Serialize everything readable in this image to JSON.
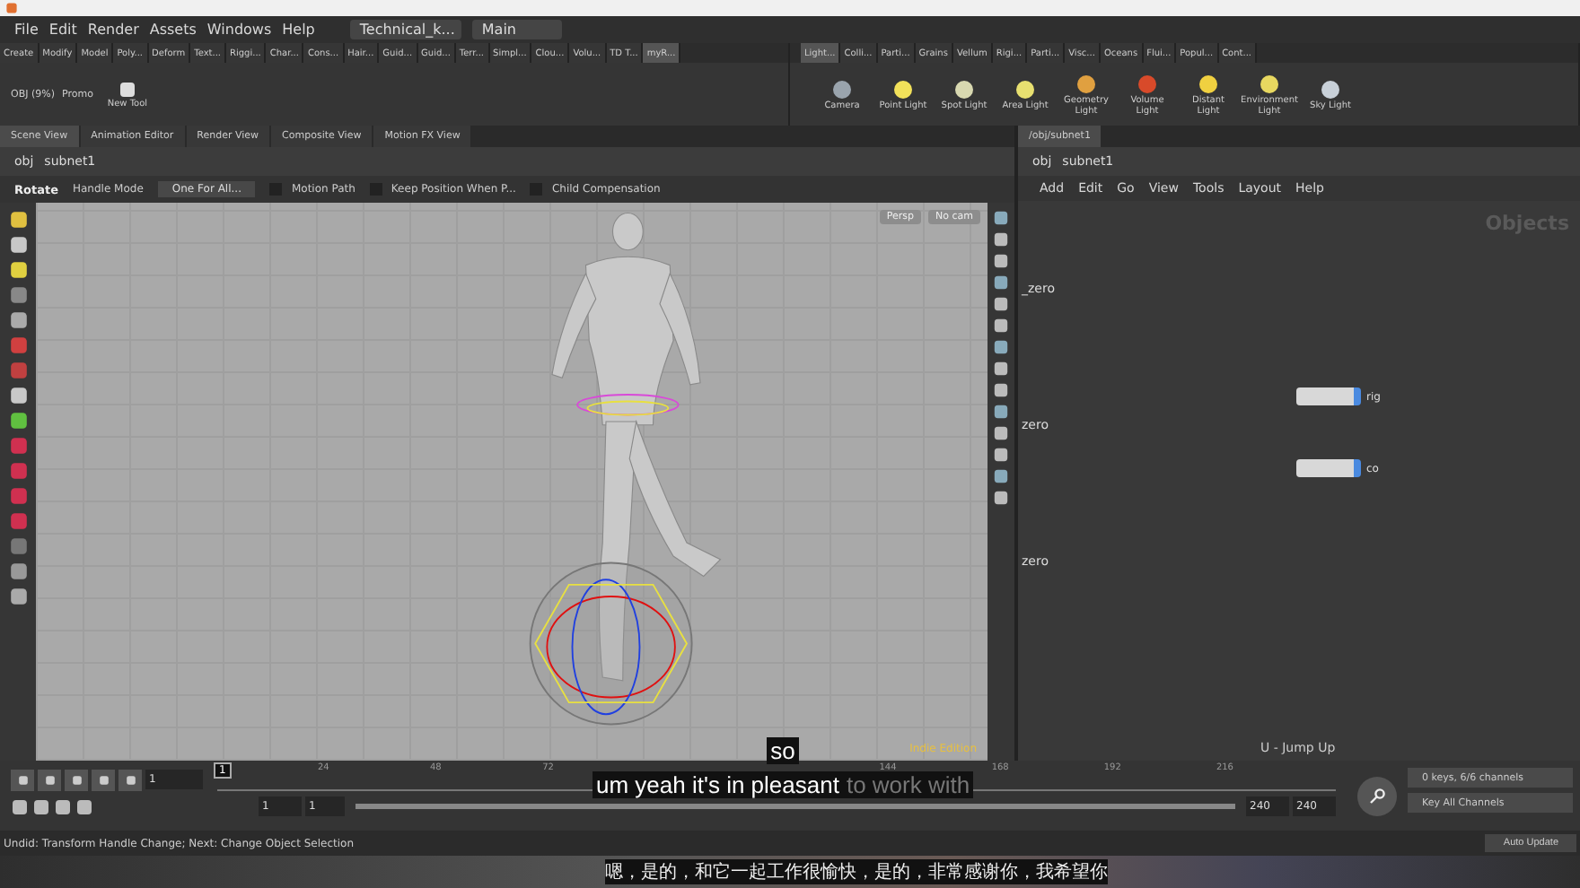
{
  "menu": [
    "File",
    "Edit",
    "Render",
    "Assets",
    "Windows",
    "Help"
  ],
  "desktop": "Technical_k...",
  "desk": "Main",
  "shelf_tabs_left": [
    {
      "label": "Create",
      "selected": false
    },
    {
      "label": "Modify",
      "selected": false
    },
    {
      "label": "Model",
      "selected": false
    },
    {
      "label": "Poly...",
      "selected": false
    },
    {
      "label": "Deform",
      "selected": false
    },
    {
      "label": "Text...",
      "selected": false
    },
    {
      "label": "Riggi...",
      "selected": false
    },
    {
      "label": "Char...",
      "selected": false
    },
    {
      "label": "Cons...",
      "selected": false
    },
    {
      "label": "Hair...",
      "selected": false
    },
    {
      "label": "Guid...",
      "selected": false
    },
    {
      "label": "Guid...",
      "selected": false
    },
    {
      "label": "Terr...",
      "selected": false
    },
    {
      "label": "Simpl...",
      "selected": false
    },
    {
      "label": "Clou...",
      "selected": false
    },
    {
      "label": "Volu...",
      "selected": false
    },
    {
      "label": "TD T...",
      "selected": false
    },
    {
      "label": "myR...",
      "selected": true
    }
  ],
  "shelf_tools_left": [
    {
      "label": "OBJ (9%)",
      "kind": "text"
    },
    {
      "label": "Promo",
      "kind": "text"
    },
    {
      "label": "New Tool",
      "kind": "icon"
    }
  ],
  "shelf_tabs_right": [
    {
      "label": "Light...",
      "selected": true
    },
    {
      "label": "Colli...",
      "selected": false
    },
    {
      "label": "Parti...",
      "selected": false
    },
    {
      "label": "Grains",
      "selected": false
    },
    {
      "label": "Vellum",
      "selected": false
    },
    {
      "label": "Rigi...",
      "selected": false
    },
    {
      "label": "Parti...",
      "selected": false
    },
    {
      "label": "Visc...",
      "selected": false
    },
    {
      "label": "Oceans",
      "selected": false
    },
    {
      "label": "Flui...",
      "selected": false
    },
    {
      "label": "Popul...",
      "selected": false
    },
    {
      "label": "Cont...",
      "selected": false
    }
  ],
  "shelf_tools_right": [
    {
      "label": "Camera",
      "color": "#9aa4ad"
    },
    {
      "label": "Point Light",
      "color": "#f2e15a"
    },
    {
      "label": "Spot Light",
      "color": "#d8d8b0"
    },
    {
      "label": "Area Light",
      "color": "#e8e070"
    },
    {
      "label": "Geometry Light",
      "color": "#e0a040"
    },
    {
      "label": "Volume Light",
      "color": "#d84a2a"
    },
    {
      "label": "Distant Light",
      "color": "#f0d040"
    },
    {
      "label": "Environment Light",
      "color": "#e8d860"
    },
    {
      "label": "Sky Light",
      "color": "#c8d0d8"
    }
  ],
  "pane_tabs": [
    {
      "label": "Scene View",
      "selected": true
    },
    {
      "label": "Animation Editor",
      "selected": false
    },
    {
      "label": "Render View",
      "selected": false
    },
    {
      "label": "Composite View",
      "selected": false
    },
    {
      "label": "Motion FX View",
      "selected": false
    }
  ],
  "network_tab": "/obj/subnet1",
  "path": [
    "obj",
    "subnet1"
  ],
  "network_path": [
    "obj",
    "subnet1"
  ],
  "tool_options": {
    "tool": "Rotate",
    "handle_label": "Handle Mode",
    "handle_mode": "One For All...",
    "checkboxes": [
      {
        "label": "Motion Path",
        "checked": false
      },
      {
        "label": "Keep Position When P...",
        "checked": false
      },
      {
        "label": "Child Compensation",
        "checked": false
      }
    ]
  },
  "viewport": {
    "camera": "Persp",
    "cam": "No cam",
    "edition": "Indie Edition"
  },
  "subtitles": {
    "line1": "so",
    "spoken": "um yeah it's in pleasant",
    "upcoming": "to work with",
    "chinese": "嗯，是的，和它一起工作很愉快，是的，非常感谢你，我希望你"
  },
  "network": {
    "menu": [
      "Add",
      "Edit",
      "Go",
      "View",
      "Tools",
      "Layout",
      "Help"
    ],
    "context": "Objects",
    "side_labels": [
      "_zero",
      "zero",
      "zero"
    ],
    "nodes": [
      {
        "label": "rig"
      },
      {
        "label": "co"
      }
    ],
    "hotkey": "U - Jump Up"
  },
  "timeline": {
    "frame": "1",
    "marker": "1",
    "ticks": [
      "24",
      "48",
      "72",
      "144",
      "168",
      "192",
      "216"
    ],
    "range_bar": {
      "level": 1
    },
    "start": "1",
    "range_start": "1",
    "range_end": "240",
    "end": "240",
    "keys": "0 keys, 6/6 channels",
    "key_all": "Key All Channels"
  },
  "status": "Undid: Transform Handle Change; Next: Change Object Selection",
  "auto_update": "Auto Update"
}
